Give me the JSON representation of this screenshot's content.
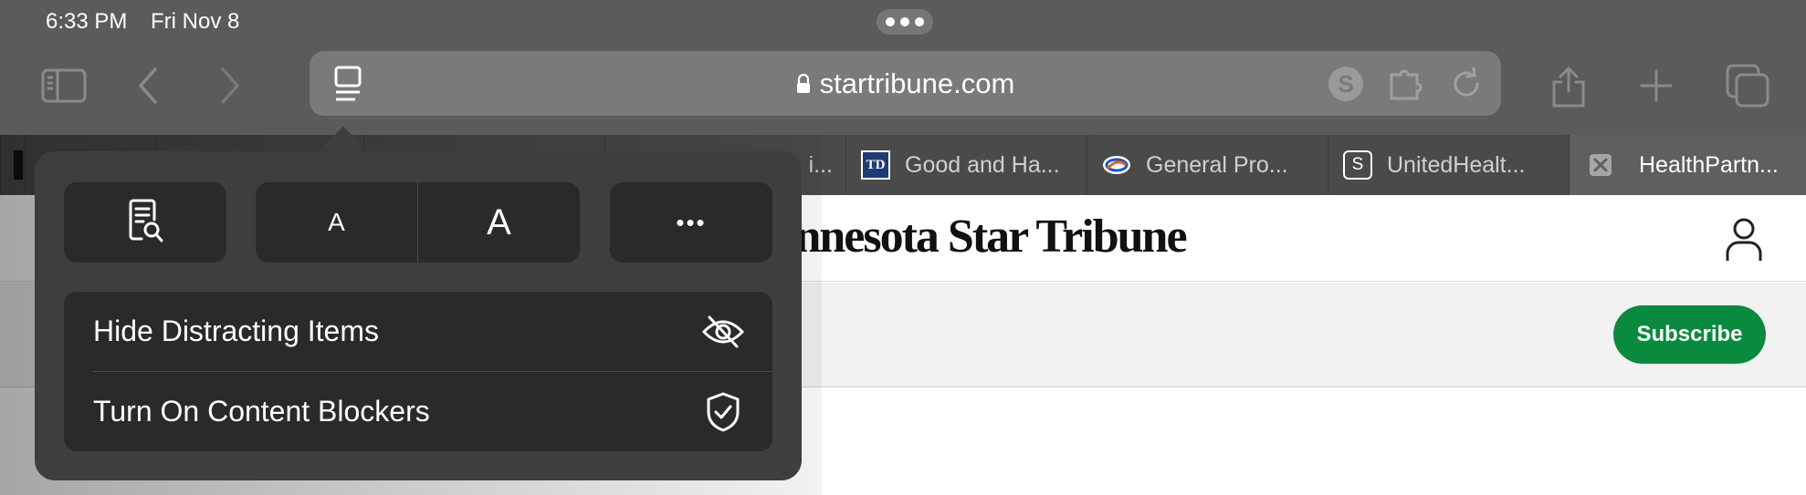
{
  "status_bar": {
    "time": "6:33 PM",
    "date": "Fri Nov 8"
  },
  "url_bar": {
    "domain": "startribune.com"
  },
  "tabs": [
    {
      "title": "",
      "favicon": "partial-favicon-icon"
    },
    {
      "title": "",
      "favicon": "partial-favicon-icon"
    },
    {
      "title": "",
      "favicon": "partial-favicon-icon"
    },
    {
      "title": "i...",
      "favicon": "partial-favicon-icon"
    },
    {
      "title": "Good and Ha...",
      "favicon": "td-favicon-icon",
      "favicon_text": "TD"
    },
    {
      "title": "General Pro...",
      "favicon": "gm-favicon-icon"
    },
    {
      "title": "UnitedHealt...",
      "favicon": "s-favicon-icon",
      "favicon_text": "S"
    },
    {
      "title": "HealthPartn...",
      "favicon": "close-tab-icon",
      "active": true
    }
  ],
  "page": {
    "brand": "innesota Star Tribune",
    "subscribe_label": "Subscribe"
  },
  "popover": {
    "small_a": "A",
    "large_a": "A",
    "more_label": "•••",
    "rows": [
      {
        "label": "Hide Distracting Items",
        "icon": "eye-slash-icon"
      },
      {
        "label": "Turn On Content Blockers",
        "icon": "shield-check-icon"
      }
    ]
  },
  "colors": {
    "chrome": "#5b5b5b",
    "popover": "#3e3e3e",
    "popover_button": "#2a2a2b",
    "subscribe": "#0a8a3f"
  }
}
